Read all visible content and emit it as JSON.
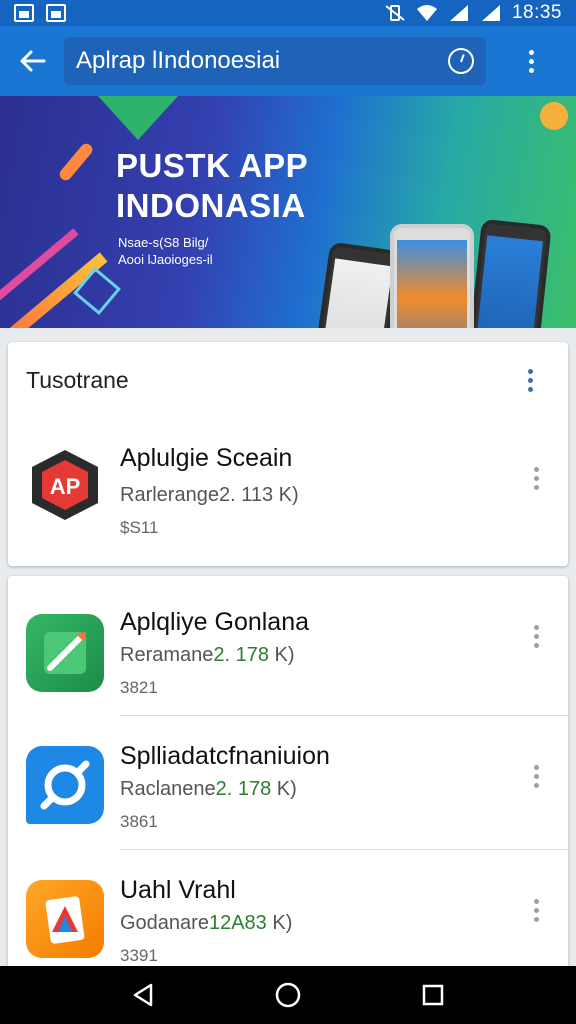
{
  "status_bar": {
    "time": "18:35",
    "left_icons": [
      "image-notification-icon",
      "gallery-notification-icon"
    ],
    "right_icons": [
      "vibrate-icon",
      "wifi-icon",
      "signal-icon",
      "signal-icon-2"
    ]
  },
  "app_bar": {
    "search_text": "Aplrap lIndonoesiai",
    "back_icon": "arrow-left-icon",
    "voice_icon": "compass-icon",
    "overflow_icon": "more-vertical-icon"
  },
  "banner": {
    "title_line1": "PUSTK APP",
    "title_line2": "INDONASIA",
    "sub_line1": "Nsae-s(S8 Bilg/",
    "sub_line2": "Aooi lJaoioges-il"
  },
  "section1": {
    "header": "Tusotrane",
    "apps": [
      {
        "name": "Aplulgie Sceain",
        "meta_prefix": "Rarlerange",
        "meta_version": "2. 113",
        "meta_suffix": " K)",
        "price": "$S11",
        "icon": "ap-logo-icon"
      }
    ]
  },
  "section2": {
    "apps": [
      {
        "name": "Aplqliye Gonlana",
        "meta_prefix": "Reramane",
        "meta_version": "2. 178",
        "meta_suffix": " K)",
        "price": "3821",
        "icon": "pen-icon"
      },
      {
        "name": "Splliadatcfnaniuion",
        "meta_prefix": "Raclanene",
        "meta_version": "2. 178",
        "meta_suffix": " K)",
        "price": "3861",
        "icon": "sync-icon"
      },
      {
        "name": "Uahl Vrahl",
        "meta_prefix": "Godanare",
        "meta_version": "12A83",
        "meta_suffix": " K)",
        "price": "3391",
        "icon": "tag-icon"
      }
    ]
  },
  "nav_bar": {
    "back": "nav-back-icon",
    "home": "nav-home-icon",
    "recents": "nav-recents-icon"
  },
  "colors": {
    "app_bar": "#1976d2",
    "status_bar": "#1565c0",
    "accent_green": "#2e7d32"
  }
}
